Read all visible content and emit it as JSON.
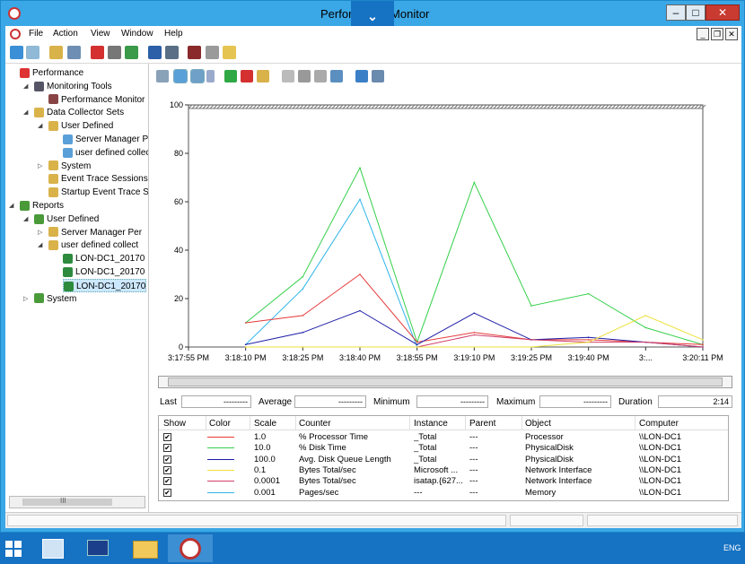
{
  "window": {
    "title": "Performance Monitor",
    "caption_overlay": "⌄",
    "minimize": "–",
    "maximize": "□",
    "close": "✕"
  },
  "menu": {
    "items": [
      "File",
      "Action",
      "View",
      "Window",
      "Help"
    ],
    "mdi_min": "_",
    "mdi_restore": "❐",
    "mdi_close": "✕"
  },
  "tree": {
    "nodes": [
      {
        "label": "Performance",
        "depth": 0,
        "expander": "",
        "icon_color": "#d33"
      },
      {
        "label": "Monitoring Tools",
        "depth": 1,
        "expander": "◢",
        "icon_color": "#556"
      },
      {
        "label": "Performance Monitor",
        "depth": 2,
        "expander": "",
        "icon_color": "#844"
      },
      {
        "label": "Data Collector Sets",
        "depth": 1,
        "expander": "◢",
        "icon_color": "#d9b24a"
      },
      {
        "label": "User Defined",
        "depth": 2,
        "expander": "◢",
        "icon_color": "#d9b24a"
      },
      {
        "label": "Server Manager Per",
        "depth": 3,
        "expander": "",
        "icon_color": "#5aa0d8"
      },
      {
        "label": "user defined collect",
        "depth": 3,
        "expander": "",
        "icon_color": "#5aa0d8"
      },
      {
        "label": "System",
        "depth": 2,
        "expander": "▷",
        "icon_color": "#d9b24a"
      },
      {
        "label": "Event Trace Sessions",
        "depth": 2,
        "expander": "",
        "icon_color": "#d9b24a"
      },
      {
        "label": "Startup Event Trace Ses",
        "depth": 2,
        "expander": "",
        "icon_color": "#d9b24a"
      },
      {
        "label": "Reports",
        "depth": 0,
        "expander": "◢",
        "icon_color": "#4a9a3a"
      },
      {
        "label": "User Defined",
        "depth": 1,
        "expander": "◢",
        "icon_color": "#4a9a3a"
      },
      {
        "label": "Server Manager Per",
        "depth": 2,
        "expander": "▷",
        "icon_color": "#d9b24a"
      },
      {
        "label": "user defined collect",
        "depth": 2,
        "expander": "◢",
        "icon_color": "#d9b24a"
      },
      {
        "label": "LON-DC1_20170",
        "depth": 3,
        "expander": "",
        "icon_color": "#2e8b3e"
      },
      {
        "label": "LON-DC1_20170",
        "depth": 3,
        "expander": "",
        "icon_color": "#2e8b3e"
      },
      {
        "label": "LON-DC1_20170",
        "depth": 3,
        "expander": "",
        "icon_color": "#2e8b3e",
        "selected": true
      },
      {
        "label": "System",
        "depth": 1,
        "expander": "▷",
        "icon_color": "#4a9a3a"
      }
    ],
    "scroll_glyph": "III"
  },
  "stats": {
    "last_label": "Last",
    "last_value": "---------",
    "average_label": "Average",
    "average_value": "---------",
    "minimum_label": "Minimum",
    "minimum_value": "---------",
    "maximum_label": "Maximum",
    "maximum_value": "---------",
    "duration_label": "Duration",
    "duration_value": "2:14"
  },
  "counters": {
    "headers": [
      "Show",
      "Color",
      "Scale",
      "Counter",
      "Instance",
      "Parent",
      "Object",
      "Computer"
    ],
    "check_glyph": "✔",
    "rows": [
      {
        "color": "#e53a3a",
        "scale": "1.0",
        "counter": "% Processor Time",
        "instance": "_Total",
        "parent": "---",
        "object": "Processor",
        "computer": "\\\\LON-DC1"
      },
      {
        "color": "#34d04a",
        "scale": "10.0",
        "counter": "% Disk Time",
        "instance": "_Total",
        "parent": "---",
        "object": "PhysicalDisk",
        "computer": "\\\\LON-DC1"
      },
      {
        "color": "#1c1ca8",
        "scale": "100.0",
        "counter": "Avg. Disk Queue Length",
        "instance": "_Total",
        "parent": "---",
        "object": "PhysicalDisk",
        "computer": "\\\\LON-DC1"
      },
      {
        "color": "#ece13a",
        "scale": "0.1",
        "counter": "Bytes Total/sec",
        "instance": "Microsoft ...",
        "parent": "---",
        "object": "Network Interface",
        "computer": "\\\\LON-DC1"
      },
      {
        "color": "#d0406a",
        "scale": "0.0001",
        "counter": "Bytes Total/sec",
        "instance": "isatap.{627...",
        "parent": "---",
        "object": "Network Interface",
        "computer": "\\\\LON-DC1"
      },
      {
        "color": "#2eb4e8",
        "scale": "0.001",
        "counter": "Pages/sec",
        "instance": "---",
        "parent": "---",
        "object": "Memory",
        "computer": "\\\\LON-DC1"
      }
    ]
  },
  "taskbar": {
    "language": "ENG"
  },
  "chart_data": {
    "type": "line",
    "x": [
      "3:17:55 PM",
      "3:18:10 PM",
      "3:18:25 PM",
      "3:18:40 PM",
      "3:18:55 PM",
      "3:19:10 PM",
      "3:19:25 PM",
      "3:19:40 PM",
      "3:...",
      "3:20:11 PM"
    ],
    "ylim": [
      0,
      100
    ],
    "yticks": [
      "0",
      "20",
      "40",
      "60",
      "80",
      "100"
    ],
    "grid": false,
    "series": [
      {
        "color": "#34d04a",
        "values": [
          null,
          10,
          29,
          74,
          2,
          68,
          17,
          22,
          8,
          1
        ]
      },
      {
        "color": "#2eb4e8",
        "values": [
          null,
          1,
          24,
          61,
          0,
          null,
          null,
          null,
          null,
          null
        ]
      },
      {
        "color": "#e53a3a",
        "values": [
          null,
          10,
          13,
          30,
          2,
          6,
          3,
          3,
          2,
          1
        ]
      },
      {
        "color": "#1c1ca8",
        "values": [
          null,
          1,
          6,
          15,
          1,
          14,
          3,
          4,
          2,
          0
        ]
      },
      {
        "color": "#d0406a",
        "values": [
          null,
          0,
          0,
          0,
          0,
          5,
          3,
          2,
          2,
          0
        ]
      },
      {
        "color": "#ece13a",
        "values": [
          null,
          0,
          0,
          0,
          0,
          0,
          0,
          2,
          13,
          3
        ]
      }
    ]
  }
}
